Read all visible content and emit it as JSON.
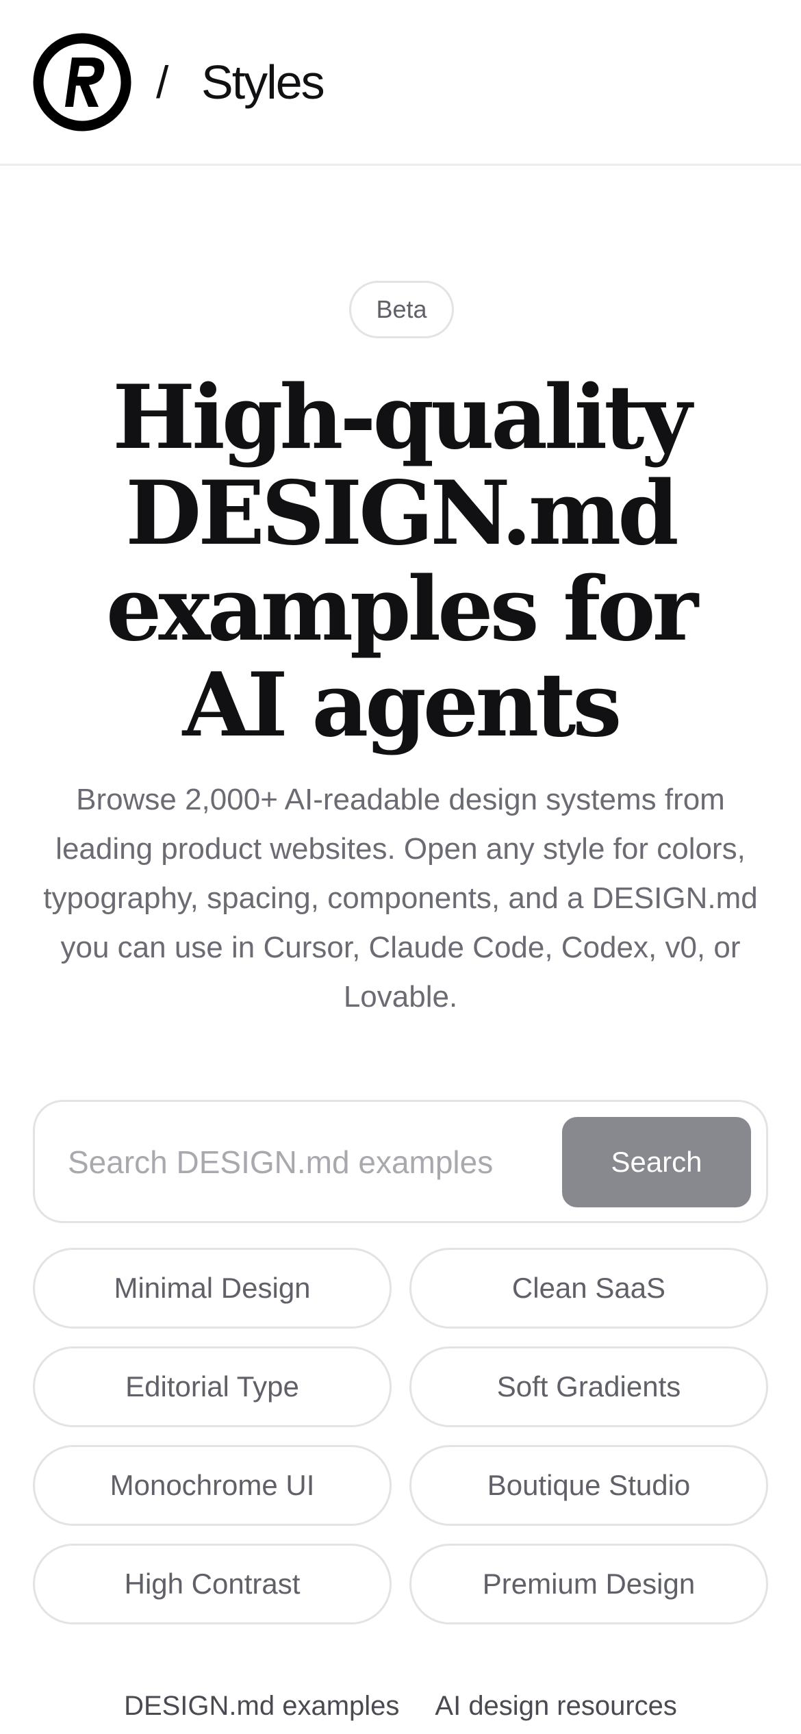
{
  "header": {
    "logo_icon": "registered-r-icon",
    "breadcrumb_separator": "/",
    "title": "Styles"
  },
  "badge": {
    "label": "Beta"
  },
  "hero": {
    "lines": [
      "High-quality",
      "DESIGN.md",
      "examples for",
      "AI agents"
    ]
  },
  "lede": "Browse 2,000+ AI-readable design systems from leading product websites. Open any style for colors, typography, spacing, components, and a DESIGN.md you can use in Cursor, Claude Code, Codex, v0, or Lovable.",
  "search": {
    "placeholder": "Search DESIGN.md examples",
    "value": "",
    "button_label": "Search"
  },
  "chips": [
    "Minimal Design",
    "Clean SaaS",
    "Editorial Type",
    "Soft Gradients",
    "Monochrome UI",
    "Boutique Studio",
    "High Contrast",
    "Premium Design"
  ],
  "footer_links": [
    "DESIGN.md examples",
    "AI design resources"
  ],
  "colors": {
    "text": "#111114",
    "muted": "#6a6b73",
    "border": "#e3e3e6",
    "button": "#88898e"
  }
}
